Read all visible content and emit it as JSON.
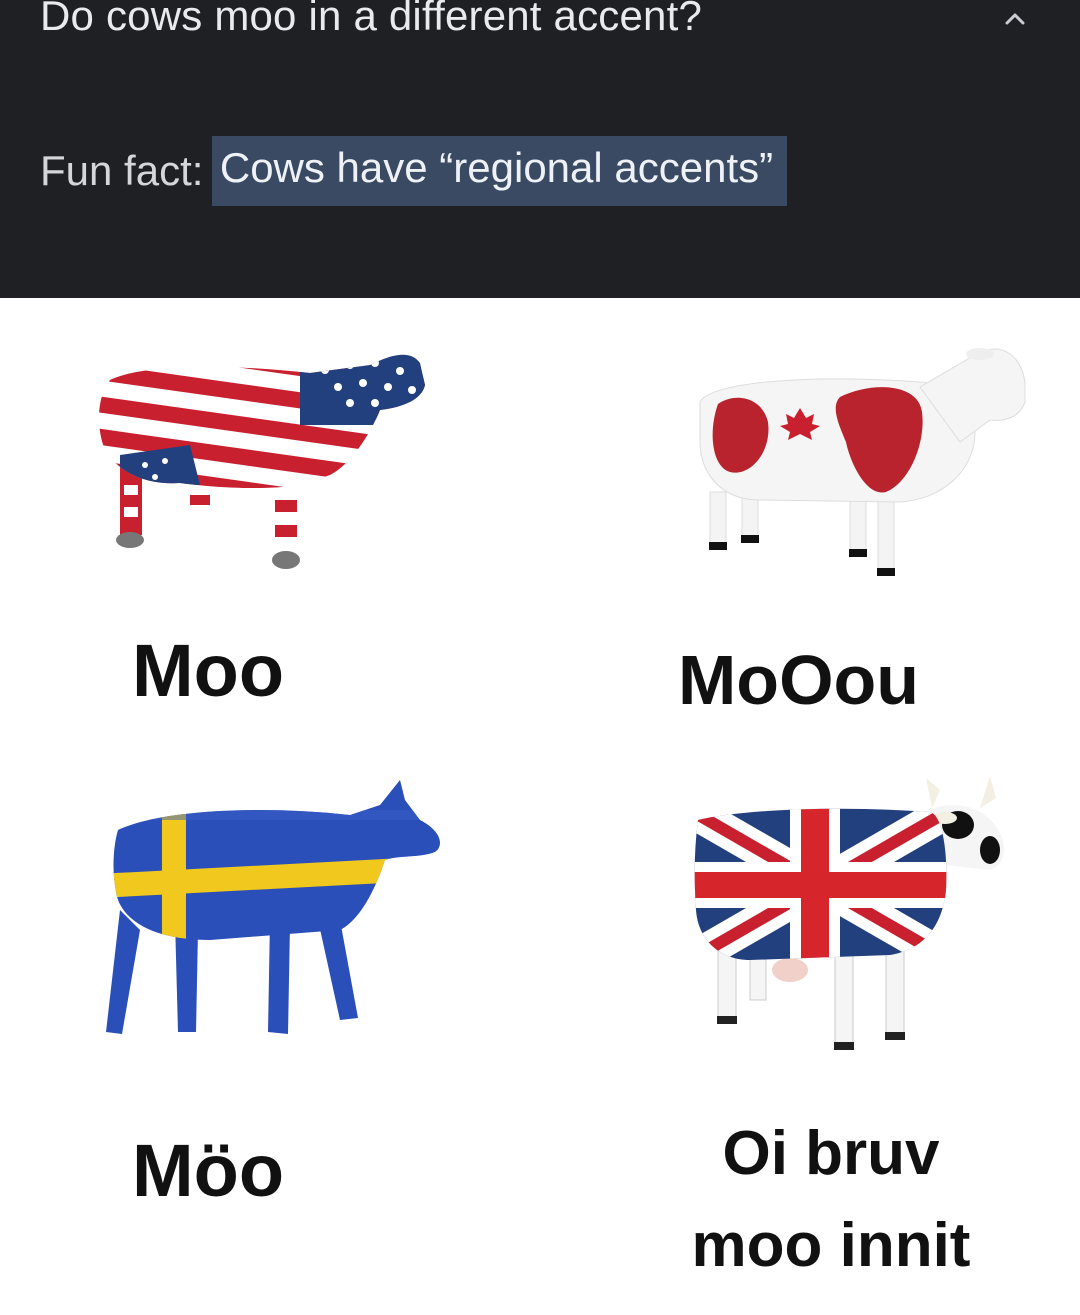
{
  "question": "Do cows moo in a different accent?",
  "fun_fact": {
    "label": "Fun fact:",
    "highlight": "Cows have “regional accents”"
  },
  "icons": {
    "collapse": "chevron-up-icon"
  },
  "cows": [
    {
      "id": "usa",
      "caption": "Moo",
      "pattern": "american-flag"
    },
    {
      "id": "canada",
      "caption": "MoOou",
      "pattern": "canadian-flag"
    },
    {
      "id": "sweden",
      "caption": "Möo",
      "pattern": "swedish-flag"
    },
    {
      "id": "uk",
      "caption_line1": "Oi bruv",
      "caption_line2": "moo innit",
      "pattern": "union-jack"
    }
  ],
  "colors": {
    "panel_bg": "#1e2024",
    "highlight_bg": "#3a4a63",
    "flag_red": "#c8202f",
    "flag_blue": "#23407e",
    "swedish_blue": "#2a4fb8",
    "swedish_yellow": "#f0c81e"
  }
}
